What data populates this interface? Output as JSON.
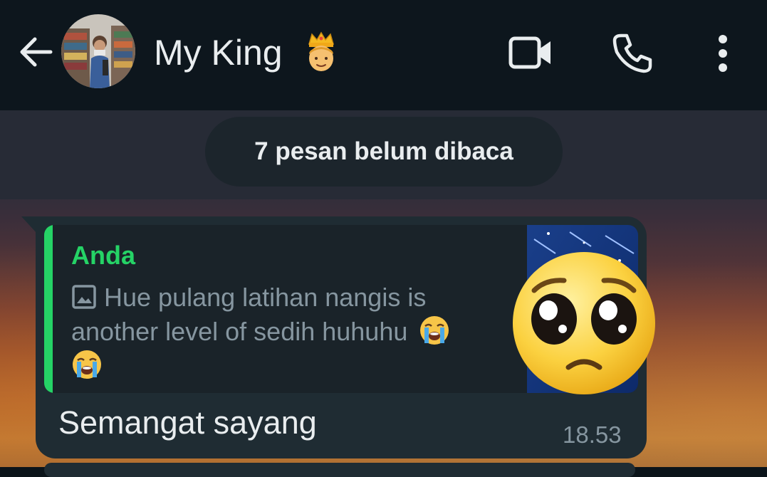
{
  "header": {
    "back_icon": "arrow-left-icon",
    "avatar_icon": "contact-avatar",
    "contact_name": "My King",
    "contact_emoji": "crown-prince-emoji",
    "video_icon": "video-camera-icon",
    "call_icon": "phone-icon",
    "menu_icon": "more-vertical-icon"
  },
  "chat": {
    "unread_banner": "7 pesan belum dibaca",
    "message": {
      "quote": {
        "author": "Anda",
        "media_icon": "image-icon",
        "text": "Hue pulang latihan nangis is another level of sedih huhuhu",
        "emoji": "loudly-crying-face-emoji",
        "thumbnail_emoji": "pleading-face-emoji"
      },
      "text": "Semangat sayang",
      "time": "18.53"
    }
  },
  "colors": {
    "header_bg": "#0d161d",
    "bubble_bg": "#1f2c33",
    "accent_green": "#25d366",
    "text_primary": "#e9edef",
    "text_secondary": "#8696a0"
  }
}
